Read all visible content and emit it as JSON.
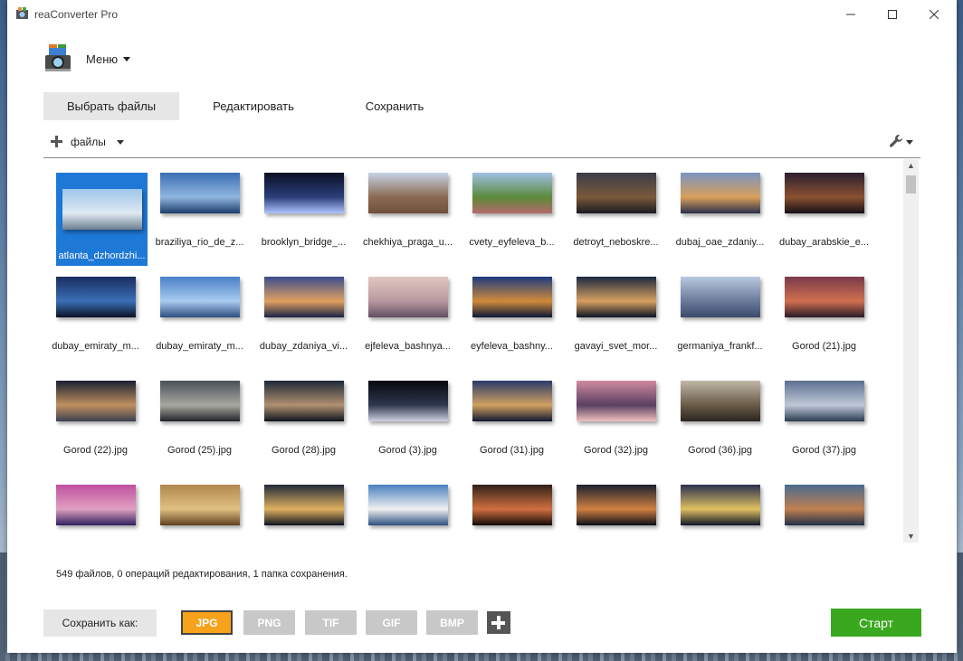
{
  "window": {
    "title": "reaConverter Pro"
  },
  "menu": {
    "label": "Меню"
  },
  "tabs": [
    "Выбрать файлы",
    "Редактировать",
    "Сохранить"
  ],
  "toolbar": {
    "files_label": "файлы"
  },
  "files": [
    {
      "name": "atlanta_dzhordzhi...",
      "colors": [
        "#9ec6ea",
        "#dfe9f2",
        "#6c7f8f"
      ],
      "selected": true
    },
    {
      "name": "braziliya_rio_de_z...",
      "colors": [
        "#3a6fb4",
        "#8fb6e0",
        "#1d3c6a"
      ]
    },
    {
      "name": "brooklyn_bridge_...",
      "colors": [
        "#0b1024",
        "#2a3e7a",
        "#b0c4ff"
      ]
    },
    {
      "name": "chekhiya_praga_u...",
      "colors": [
        "#c6d3e6",
        "#8a6a52",
        "#6e4f3c"
      ]
    },
    {
      "name": "cvety_eyfeleva_b...",
      "colors": [
        "#9fc0e6",
        "#5a8a3a",
        "#b46a6a"
      ]
    },
    {
      "name": "detroyt_neboskre...",
      "colors": [
        "#3b3b4a",
        "#7a5a3a",
        "#1a1a22"
      ]
    },
    {
      "name": "dubaj_oae_zdaniy...",
      "colors": [
        "#7a94c2",
        "#d9a05a",
        "#2a2f4a"
      ]
    },
    {
      "name": "dubay_arabskie_e...",
      "colors": [
        "#2b2030",
        "#8a5030",
        "#160f18"
      ]
    },
    {
      "name": "dubay_emiraty_m...",
      "colors": [
        "#1a2d5e",
        "#3b6fb7",
        "#0a1226"
      ]
    },
    {
      "name": "dubay_emiraty_m...",
      "colors": [
        "#4a80c8",
        "#a9cbf0",
        "#2d4d80"
      ]
    },
    {
      "name": "dubay_zdaniya_vi...",
      "colors": [
        "#3a4d8e",
        "#e0a060",
        "#1a2248"
      ]
    },
    {
      "name": "ejfeleva_bashnya...",
      "colors": [
        "#e0c8c0",
        "#b898a0",
        "#605060"
      ]
    },
    {
      "name": "eyfeleva_bashny...",
      "colors": [
        "#1d3b80",
        "#d08a3a",
        "#0a1838"
      ]
    },
    {
      "name": "gavayi_svet_mor...",
      "colors": [
        "#1a2840",
        "#d8a060",
        "#0a1424"
      ]
    },
    {
      "name": "germaniya_frankf...",
      "colors": [
        "#b8c8e0",
        "#6a7a9a",
        "#3a4a6a"
      ]
    },
    {
      "name": "Gorod (21).jpg",
      "colors": [
        "#7a3a4a",
        "#d07050",
        "#2a1a28"
      ]
    },
    {
      "name": "Gorod (22).jpg",
      "colors": [
        "#1a2030",
        "#c09060",
        "#3a4050"
      ]
    },
    {
      "name": "Gorod (25).jpg",
      "colors": [
        "#4a5058",
        "#a8a8a0",
        "#20242a"
      ]
    },
    {
      "name": "Gorod (28).jpg",
      "colors": [
        "#1e2838",
        "#b09070",
        "#0e141e"
      ]
    },
    {
      "name": "Gorod (3).jpg",
      "colors": [
        "#05070c",
        "#303850",
        "#d0d0e0"
      ]
    },
    {
      "name": "Gorod (31).jpg",
      "colors": [
        "#2a3a6a",
        "#d0a060",
        "#101830"
      ]
    },
    {
      "name": "Gorod (32).jpg",
      "colors": [
        "#d08aa0",
        "#5a4060",
        "#f0c0c0"
      ]
    },
    {
      "name": "Gorod (36).jpg",
      "colors": [
        "#c0b8a8",
        "#6a5a48",
        "#2a2420"
      ]
    },
    {
      "name": "Gorod (37).jpg",
      "colors": [
        "#5a7090",
        "#c0c8d8",
        "#2a3a50"
      ]
    },
    {
      "name": "",
      "colors": [
        "#c050a0",
        "#e0a0c0",
        "#302060"
      ]
    },
    {
      "name": "",
      "colors": [
        "#b08850",
        "#e0c080",
        "#604020"
      ]
    },
    {
      "name": "",
      "colors": [
        "#202a38",
        "#e0b060",
        "#0e1420"
      ]
    },
    {
      "name": "",
      "colors": [
        "#4a80c0",
        "#f0f0f0",
        "#2a5080"
      ]
    },
    {
      "name": "",
      "colors": [
        "#302018",
        "#d07040",
        "#100a08"
      ]
    },
    {
      "name": "",
      "colors": [
        "#1a2030",
        "#d08040",
        "#0a0e18"
      ]
    },
    {
      "name": "",
      "colors": [
        "#2a3050",
        "#e0c060",
        "#101428"
      ]
    },
    {
      "name": "",
      "colors": [
        "#4a6a90",
        "#c08050",
        "#203048"
      ]
    }
  ],
  "status": "549 файлов, 0 операций редактирования, 1 папка сохранения.",
  "save_as": {
    "label": "Сохранить как:"
  },
  "formats": [
    {
      "label": "JPG",
      "active": true
    },
    {
      "label": "PNG",
      "active": false
    },
    {
      "label": "TIF",
      "active": false
    },
    {
      "label": "GIF",
      "active": false
    },
    {
      "label": "BMP",
      "active": false
    }
  ],
  "start_label": "Старт"
}
